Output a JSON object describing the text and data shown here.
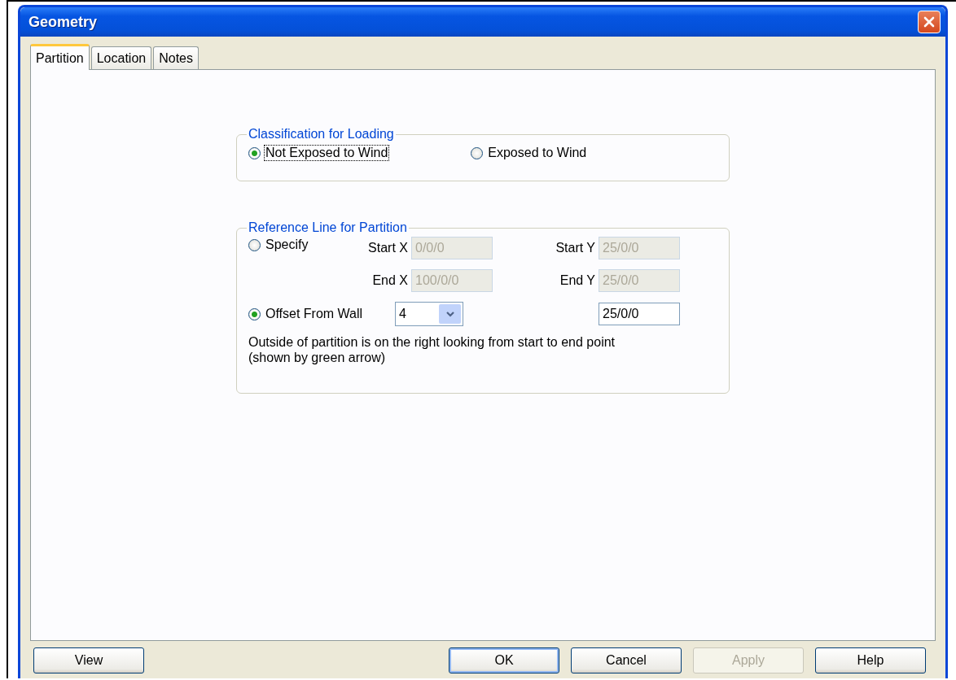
{
  "window": {
    "title": "Geometry"
  },
  "tabs": [
    {
      "label": "Partition",
      "selected": true
    },
    {
      "label": "Location",
      "selected": false
    },
    {
      "label": "Notes",
      "selected": false
    }
  ],
  "classification": {
    "title": "Classification for Loading",
    "options": [
      {
        "label": "Not Exposed to Wind",
        "selected": true,
        "focused": true
      },
      {
        "label": "Exposed to Wind",
        "selected": false,
        "focused": false
      }
    ]
  },
  "reference_line": {
    "title": "Reference Line for Partition",
    "specify": {
      "label": "Specify",
      "selected": false
    },
    "fields": [
      {
        "label": "Start X",
        "value": "0/0/0",
        "disabled": true
      },
      {
        "label": "Start Y",
        "value": "25/0/0",
        "disabled": true
      },
      {
        "label": "End X",
        "value": "100/0/0",
        "disabled": true
      },
      {
        "label": "End Y",
        "value": "25/0/0",
        "disabled": true
      }
    ],
    "offset": {
      "label": "Offset From Wall",
      "selected": true,
      "dropdown": "4",
      "value": "25/0/0"
    },
    "note": "Outside of partition is on the right looking from start to end point\n(shown by green arrow)"
  },
  "buttons": [
    {
      "label": "View",
      "disabled": false,
      "default": false
    },
    {
      "label": "OK",
      "disabled": false,
      "default": true
    },
    {
      "label": "Cancel",
      "disabled": false,
      "default": false
    },
    {
      "label": "Apply",
      "disabled": true,
      "default": false
    },
    {
      "label": "Help",
      "disabled": false,
      "default": false
    }
  ]
}
